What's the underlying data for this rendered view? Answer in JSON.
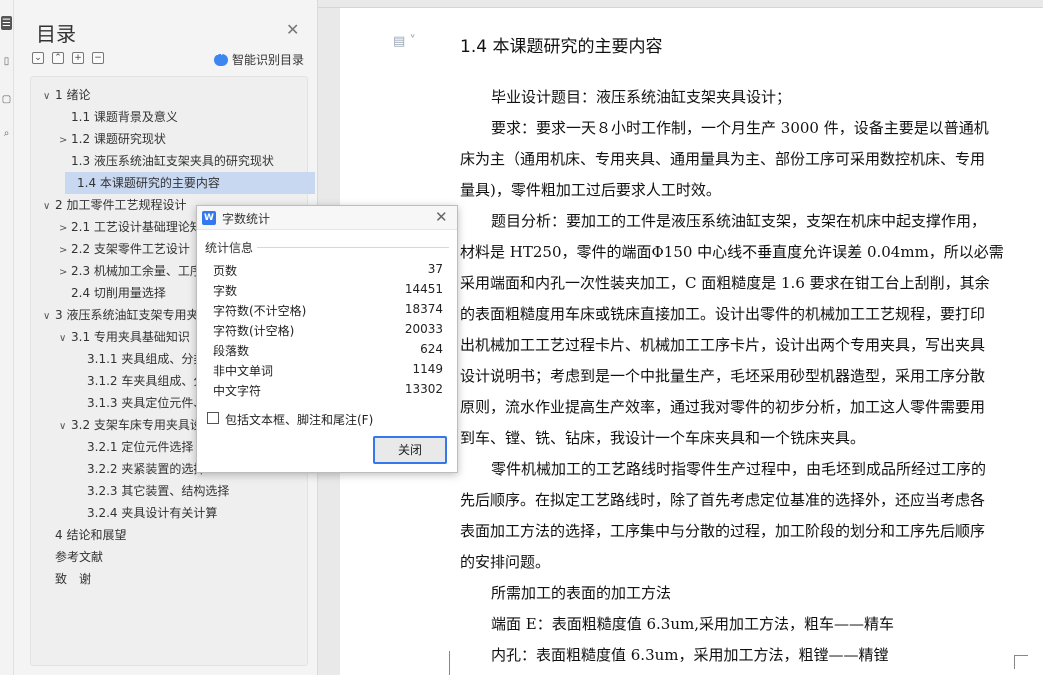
{
  "toc": {
    "title": "目录",
    "smart_label": "智能识别目录",
    "tools": [
      "⌄",
      "⌃",
      "+",
      "−"
    ],
    "items": [
      {
        "caret": "∨",
        "label": "1 绪论"
      },
      {
        "caret": "",
        "label": "1.1 课题背景及意义"
      },
      {
        "caret": ">",
        "label": "1.2 课题研究现状"
      },
      {
        "caret": "",
        "label": "1.3 液压系统油缸支架夹具的研究现状"
      },
      {
        "caret": "",
        "label": "1.4 本课题研究的主要内容"
      },
      {
        "caret": "∨",
        "label": "2 加工零件工艺规程设计"
      },
      {
        "caret": ">",
        "label": "2.1 工艺设计基础理论知"
      },
      {
        "caret": ">",
        "label": "2.2 支架零件工艺设计"
      },
      {
        "caret": ">",
        "label": "2.3 机械加工余量、工序"
      },
      {
        "caret": "",
        "label": "2.4 切削用量选择"
      },
      {
        "caret": "∨",
        "label": "3 液压系统油缸支架专用夹"
      },
      {
        "caret": "∨",
        "label": "3.1 专用夹具基础知识"
      },
      {
        "caret": "",
        "label": "3.1.1 夹具组成、分类"
      },
      {
        "caret": "",
        "label": "3.1.2 车夹具组成、分"
      },
      {
        "caret": "",
        "label": "3.1.3 夹具定位元件、"
      },
      {
        "caret": "∨",
        "label": "3.2 支架车床专用夹具设"
      },
      {
        "caret": "",
        "label": "3.2.1 定位元件选择"
      },
      {
        "caret": "",
        "label": "3.2.2 夹紧装置的选择"
      },
      {
        "caret": "",
        "label": "3.2.3 其它装置、结构选择"
      },
      {
        "caret": "",
        "label": "3.2.4 夹具设计有关计算"
      },
      {
        "caret": "",
        "label": "4 结论和展望"
      },
      {
        "caret": "",
        "label": "参考文献"
      },
      {
        "caret": "",
        "label": "致　谢"
      }
    ]
  },
  "document": {
    "heading": "1.4 本课题研究的主要内容",
    "lines": [
      "毕业设计题目：液压系统油缸支架夹具设计；",
      "要求：要求一天８小时工作制，一个月生产 3000 件，设备主要是以普通机",
      "床为主（通用机床、专用夹具、通用量具为主、部份工序可采用数控机床、专用",
      "量具)，零件粗加工过后要求人工时效。",
      "题目分析：要加工的工件是液压系统油缸支架，支架在机床中起支撑作用，",
      "材料是 HT250，零件的端面Φ150 中心线不垂直度允许误差 0.04mm，所以必需",
      "采用端面和内孔一次性装夹加工，C 面粗糙度是 1.6 要求在钳工台上刮削，其余",
      "的表面粗糙度用车床或铣床直接加工。设计出零件的机械加工工艺规程，要打印",
      "出机械加工工艺过程卡片、机械加工工序卡片，设计出两个专用夹具，写出夹具",
      "设计说明书；考虑到是一个中批量生产，毛坯采用砂型机器造型，采用工序分散",
      "原则，流水作业提高生产效率，通过我对零件的初步分析，加工这人零件需要用",
      "到车、镗、铣、钻床，我设计一个车床夹具和一个铣床夹具。",
      "零件机械加工的工艺路线时指零件生产过程中，由毛坯到成品所经过工序的",
      "先后顺序。在拟定工艺路线时，除了首先考虑定位基准的选择外，还应当考虑各",
      "表面加工方法的选择，工序集中与分散的过程，加工阶段的划分和工序先后顺序",
      "的安排问题。",
      "所需加工的表面的加工方法",
      "端面 E：表面粗糙度值 6.3um,采用加工方法，粗车——精车",
      "内孔：表面粗糙度值 6.3um，采用加工方法，粗镗——精镗"
    ]
  },
  "dialog": {
    "title": "字数统计",
    "section": "统计信息",
    "stats": [
      {
        "label": "页数",
        "value": "37"
      },
      {
        "label": "字数",
        "value": "14451"
      },
      {
        "label": "字符数(不计空格)",
        "value": "18374"
      },
      {
        "label": "字符数(计空格)",
        "value": "20033"
      },
      {
        "label": "段落数",
        "value": "624"
      },
      {
        "label": "非中文单词",
        "value": "1149"
      },
      {
        "label": "中文字符",
        "value": "13302"
      }
    ],
    "checkbox_label": "包括文本框、脚注和尾注(F)",
    "checkbox_checked": false,
    "close_label": "关闭"
  }
}
